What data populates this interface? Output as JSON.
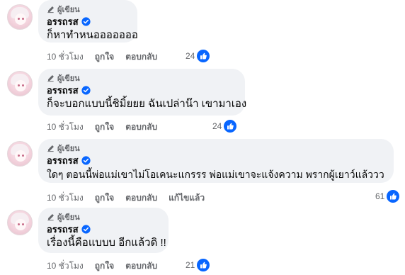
{
  "comments": [
    {
      "author_tag": "ผู้เขียน",
      "name": "อรรถรส",
      "text": "ก็หาทำหนอออออออ",
      "time": "10 ชั่วโมง",
      "like_label": "ถูกใจ",
      "reply_label": "ตอบกลับ",
      "reaction_count": "24",
      "icons": [
        "pencil-icon",
        "verified-icon",
        "like-reaction-icon"
      ]
    },
    {
      "author_tag": "ผู้เขียน",
      "name": "อรรถรส",
      "text": "ก็จะบอกแบบนี้ชิมิ้ยยย ฉันเปล่าน๊า เขามาเอง",
      "time": "10 ชั่วโมง",
      "like_label": "ถูกใจ",
      "reply_label": "ตอบกลับ",
      "reaction_count": "24"
    },
    {
      "author_tag": "ผู้เขียน",
      "name": "อรรถรส",
      "text": "ใดๆ ตอนนี้พ่อแม่เขาไม่โอเคนะแกรรร พ่อแม่เขาจะแจ้งความ พรากผู้เยาว์แล้ววว",
      "time": "10 ชั่วโมง",
      "like_label": "ถูกใจ",
      "reply_label": "ตอบกลับ",
      "edited_label": "แก้ไขแล้ว",
      "reaction_count": "61"
    },
    {
      "author_tag": "ผู้เขียน",
      "name": "อรรถรส",
      "text": "เรื่องนี้คือแบบบ อีกแล้วดิ !!",
      "time": "10 ชั่วโมง",
      "like_label": "ถูกใจ",
      "reply_label": "ตอบกลับ",
      "reaction_count": "21"
    }
  ],
  "colors": {
    "bubble": "#f0f2f5",
    "secondary_text": "#65676b",
    "facebook_blue": "#0866ff"
  }
}
